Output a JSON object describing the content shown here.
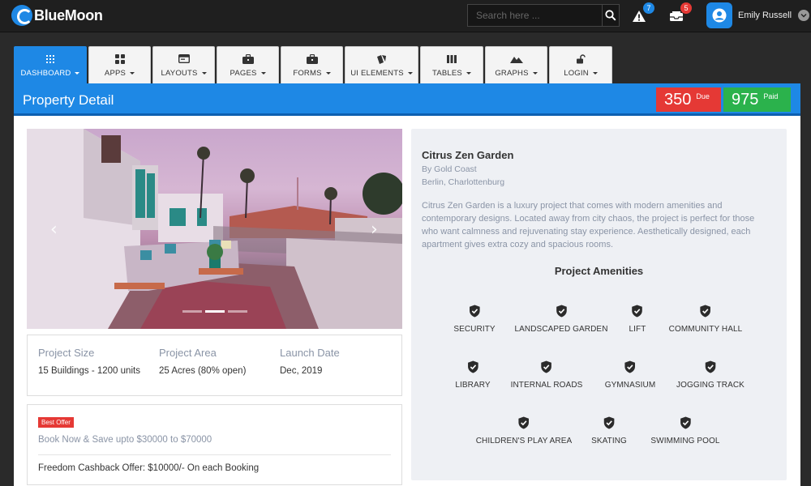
{
  "app": {
    "brand": "BlueMoon"
  },
  "topbar": {
    "search_placeholder": "Search here ...",
    "alerts_count": "7",
    "messages_count": "5",
    "user_name": "Emily Russell"
  },
  "nav": {
    "tabs": [
      {
        "label": "DASHBOARD",
        "icon": "grid-icon",
        "active": true
      },
      {
        "label": "APPS",
        "icon": "apps-icon"
      },
      {
        "label": "LAYOUTS",
        "icon": "layout-icon"
      },
      {
        "label": "PAGES",
        "icon": "briefcase-icon"
      },
      {
        "label": "FORMS",
        "icon": "briefcase-icon"
      },
      {
        "label": "UI ELEMENTS",
        "icon": "shapes-icon"
      },
      {
        "label": "TABLES",
        "icon": "columns-icon"
      },
      {
        "label": "GRAPHS",
        "icon": "mountain-icon"
      },
      {
        "label": "LOGIN",
        "icon": "lock-icon"
      }
    ]
  },
  "header": {
    "title": "Property Detail",
    "due_value": "350",
    "due_label": "Due",
    "paid_value": "975",
    "paid_label": "Paid"
  },
  "colors": {
    "primary": "#1e88e5",
    "due": "#e53935",
    "paid": "#2bb24c",
    "muted_text": "#8a94a6"
  },
  "property": {
    "facts": [
      {
        "label": "Project Size",
        "value": "15 Buildings - 1200 units"
      },
      {
        "label": "Project Area",
        "value": "25 Acres (80% open)"
      },
      {
        "label": "Launch Date",
        "value": "Dec, 2019"
      }
    ],
    "offer_badge": "Best Offer",
    "offer_text": "Book Now & Save upto $30000 to $70000",
    "cashback": "Freedom Cashback Offer: $10000/- On each Booking",
    "name": "Citrus Zen Garden",
    "builder": "By Gold Coast",
    "location": "Berlin, Charlottenburg",
    "description": "Citrus Zen Garden is a luxury project that comes with modern amenities and contemporary designs. Located away from city chaos, the project is perfect for those who want calmness and rejuvenating stay experience. Aesthetically designed, each apartment gives extra cozy and spacious rooms.",
    "amenities_title": "Project Amenities",
    "amenities": [
      "SECURITY",
      "LANDSCAPED GARDEN",
      "LIFT",
      "COMMUNITY HALL",
      "LIBRARY",
      "INTERNAL ROADS",
      "GYMNASIUM",
      "JOGGING TRACK",
      "CHILDREN'S PLAY AREA",
      "SKATING",
      "SWIMMING POOL"
    ]
  }
}
